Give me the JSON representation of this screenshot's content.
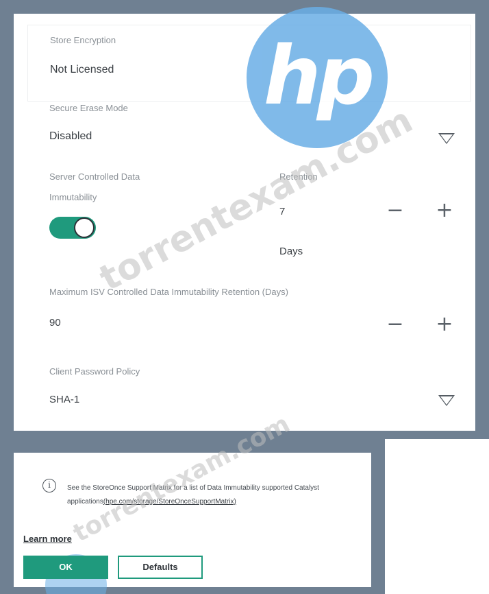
{
  "store_encryption": {
    "label": "Store Encryption",
    "value": "Not Licensed"
  },
  "secure_erase": {
    "label": "Secure Erase Mode",
    "value": "Disabled"
  },
  "server_immutability": {
    "label_line1": "Server Controlled Data",
    "label_line2": "Immutability",
    "toggle_on": true,
    "retention_label": "Retention",
    "retention_value": "7",
    "retention_unit": "Days"
  },
  "max_isv": {
    "label": "Maximum ISV Controlled Data Immutability Retention (Days)",
    "value": "90"
  },
  "client_password": {
    "label": "Client Password Policy",
    "value": "SHA-1"
  },
  "steppers": {
    "minus": "−",
    "plus": "+"
  },
  "info": {
    "text": "See the StoreOnce Support Matrix for a list of Data Immutability supported Catalyst applications",
    "link": "(hpe.com/storage/StoreOnceSupportMatrix)"
  },
  "actions": {
    "learn_more": "Learn more",
    "ok": "OK",
    "defaults": "Defaults"
  },
  "watermark": {
    "brand": "hp",
    "site": "torrentexam.com"
  },
  "colors": {
    "accent": "#1f9a7d",
    "frame": "#6f8092",
    "watermark_logo": "#6aaee6"
  }
}
